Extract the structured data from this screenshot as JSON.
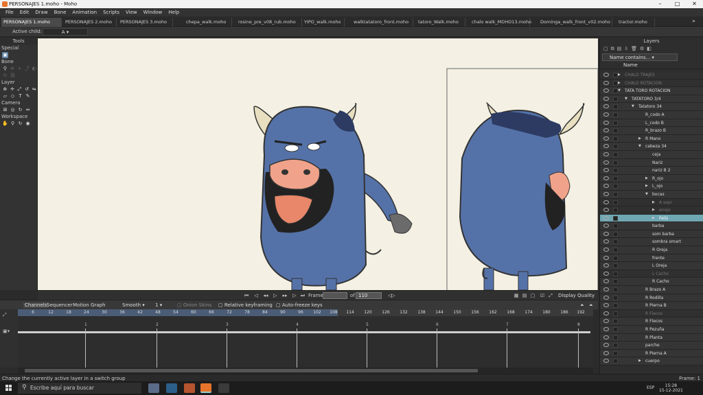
{
  "window": {
    "title": "PERSONAJES 1.moho - Moho",
    "controls": [
      "–",
      "□",
      "✕"
    ]
  },
  "menu": [
    "File",
    "Edit",
    "Draw",
    "Bone",
    "Animation",
    "Scripts",
    "View",
    "Window",
    "Help"
  ],
  "tabs": [
    "PERSONAJES 1.moho",
    "PERSONAJES 2.moho",
    "PERSONAJES 3.moho",
    "chepa_walk.moho",
    "rosine_pre_v08_rub.moho",
    "YIPO_walk.moho",
    "walktatatoro_front.moho",
    "tatoro_Walk.moho",
    "chalo walk_MOHO13.moho",
    "Dominga_walk_front_v02.moho",
    "tractor.moho"
  ],
  "tab_more": "»",
  "options": {
    "label": "Active child:",
    "value": "A"
  },
  "tools": {
    "title": "Tools",
    "sections": [
      "Special",
      "Bone",
      "Layer",
      "Camera",
      "Workspace"
    ]
  },
  "canvas": {
    "frame_label": "Frame",
    "frame_value": "",
    "of_label": "of",
    "of_value": "110",
    "display_quality": "Display Quality"
  },
  "timeline": {
    "tabs": [
      "Channels",
      "Sequencer",
      "Motion Graph"
    ],
    "interp": "Smooth",
    "count": "1",
    "onion": "Onion Skins",
    "relative": "Relative keyframing",
    "autofreeze": "Auto-freeze keys",
    "ruler": [
      "6",
      "12",
      "18",
      "24",
      "30",
      "36",
      "42",
      "48",
      "54",
      "60",
      "66",
      "72",
      "78",
      "84",
      "90",
      "96",
      "102",
      "108",
      "114",
      "120",
      "126",
      "132",
      "138",
      "144",
      "150",
      "156",
      "162",
      "168",
      "174",
      "180",
      "186",
      "192"
    ],
    "marks": [
      "1",
      "2",
      "3",
      "4",
      "5",
      "6",
      "7",
      "8"
    ]
  },
  "status": {
    "left": "Change the currently active layer in a switch group",
    "right": "Frame: 1"
  },
  "layers": {
    "title": "Layers",
    "filter": "Name contains...",
    "col_name": "Name",
    "rows": [
      {
        "name": "CHALO TRAJES",
        "indent": 0,
        "tri": "▶",
        "hidden": true
      },
      {
        "name": "CHALO ROTACION",
        "indent": 0,
        "tri": "▶",
        "hidden": true
      },
      {
        "name": "TATA TORO ROTACION",
        "indent": 0,
        "tri": "▼"
      },
      {
        "name": "TATATORO 3/4",
        "indent": 1,
        "tri": "▼"
      },
      {
        "name": "Tatatoro 34",
        "indent": 2,
        "tri": "▼"
      },
      {
        "name": "R_codo A",
        "indent": 3
      },
      {
        "name": "L_codo B",
        "indent": 3
      },
      {
        "name": "R_brazo B",
        "indent": 3
      },
      {
        "name": "R Mano",
        "indent": 3,
        "tri": "▶"
      },
      {
        "name": "cabeza 34",
        "indent": 3,
        "tri": "▼"
      },
      {
        "name": "ceja",
        "indent": 4
      },
      {
        "name": "Nariz",
        "indent": 4
      },
      {
        "name": "nariz B 2",
        "indent": 4
      },
      {
        "name": "R_ojo",
        "indent": 4,
        "tri": "▶"
      },
      {
        "name": "L_ojo",
        "indent": 4,
        "tri": "▶"
      },
      {
        "name": "bocas",
        "indent": 4,
        "tri": "▼"
      },
      {
        "name": "A sopr",
        "indent": 5,
        "tri": "▶",
        "hidden": true
      },
      {
        "name": "enojo",
        "indent": 5,
        "tri": "▶",
        "hidden": true
      },
      {
        "name": "Feliz",
        "indent": 5,
        "tri": "▶",
        "selected": true
      },
      {
        "name": "barba",
        "indent": 4
      },
      {
        "name": "som barba",
        "indent": 4
      },
      {
        "name": "sombra smart",
        "indent": 4
      },
      {
        "name": "R Oreja",
        "indent": 4
      },
      {
        "name": "frente",
        "indent": 4
      },
      {
        "name": "L Oreja",
        "indent": 4
      },
      {
        "name": "L Cacho",
        "indent": 4,
        "hidden": true
      },
      {
        "name": "R Cacho",
        "indent": 4
      },
      {
        "name": "R Brazo A",
        "indent": 3
      },
      {
        "name": "R Rodilla",
        "indent": 3
      },
      {
        "name": "R Pierna B",
        "indent": 3
      },
      {
        "name": "R Flecos",
        "indent": 3,
        "hidden": true
      },
      {
        "name": "R Flecos",
        "indent": 3
      },
      {
        "name": "R Pezuña",
        "indent": 3
      },
      {
        "name": "R Planta",
        "indent": 3
      },
      {
        "name": "parche",
        "indent": 3
      },
      {
        "name": "R Pierna A",
        "indent": 3
      },
      {
        "name": "cuerpo",
        "indent": 3,
        "tri": "▶"
      }
    ]
  },
  "taskbar": {
    "search": "Escribe aquí para buscar",
    "lang": "ESP",
    "time": "15:28",
    "date": "15-12-2021"
  },
  "colors": {
    "accent": "#6fa7b3",
    "canvas_bg": "#f4f1e4",
    "bull_body": "#5572a8"
  }
}
